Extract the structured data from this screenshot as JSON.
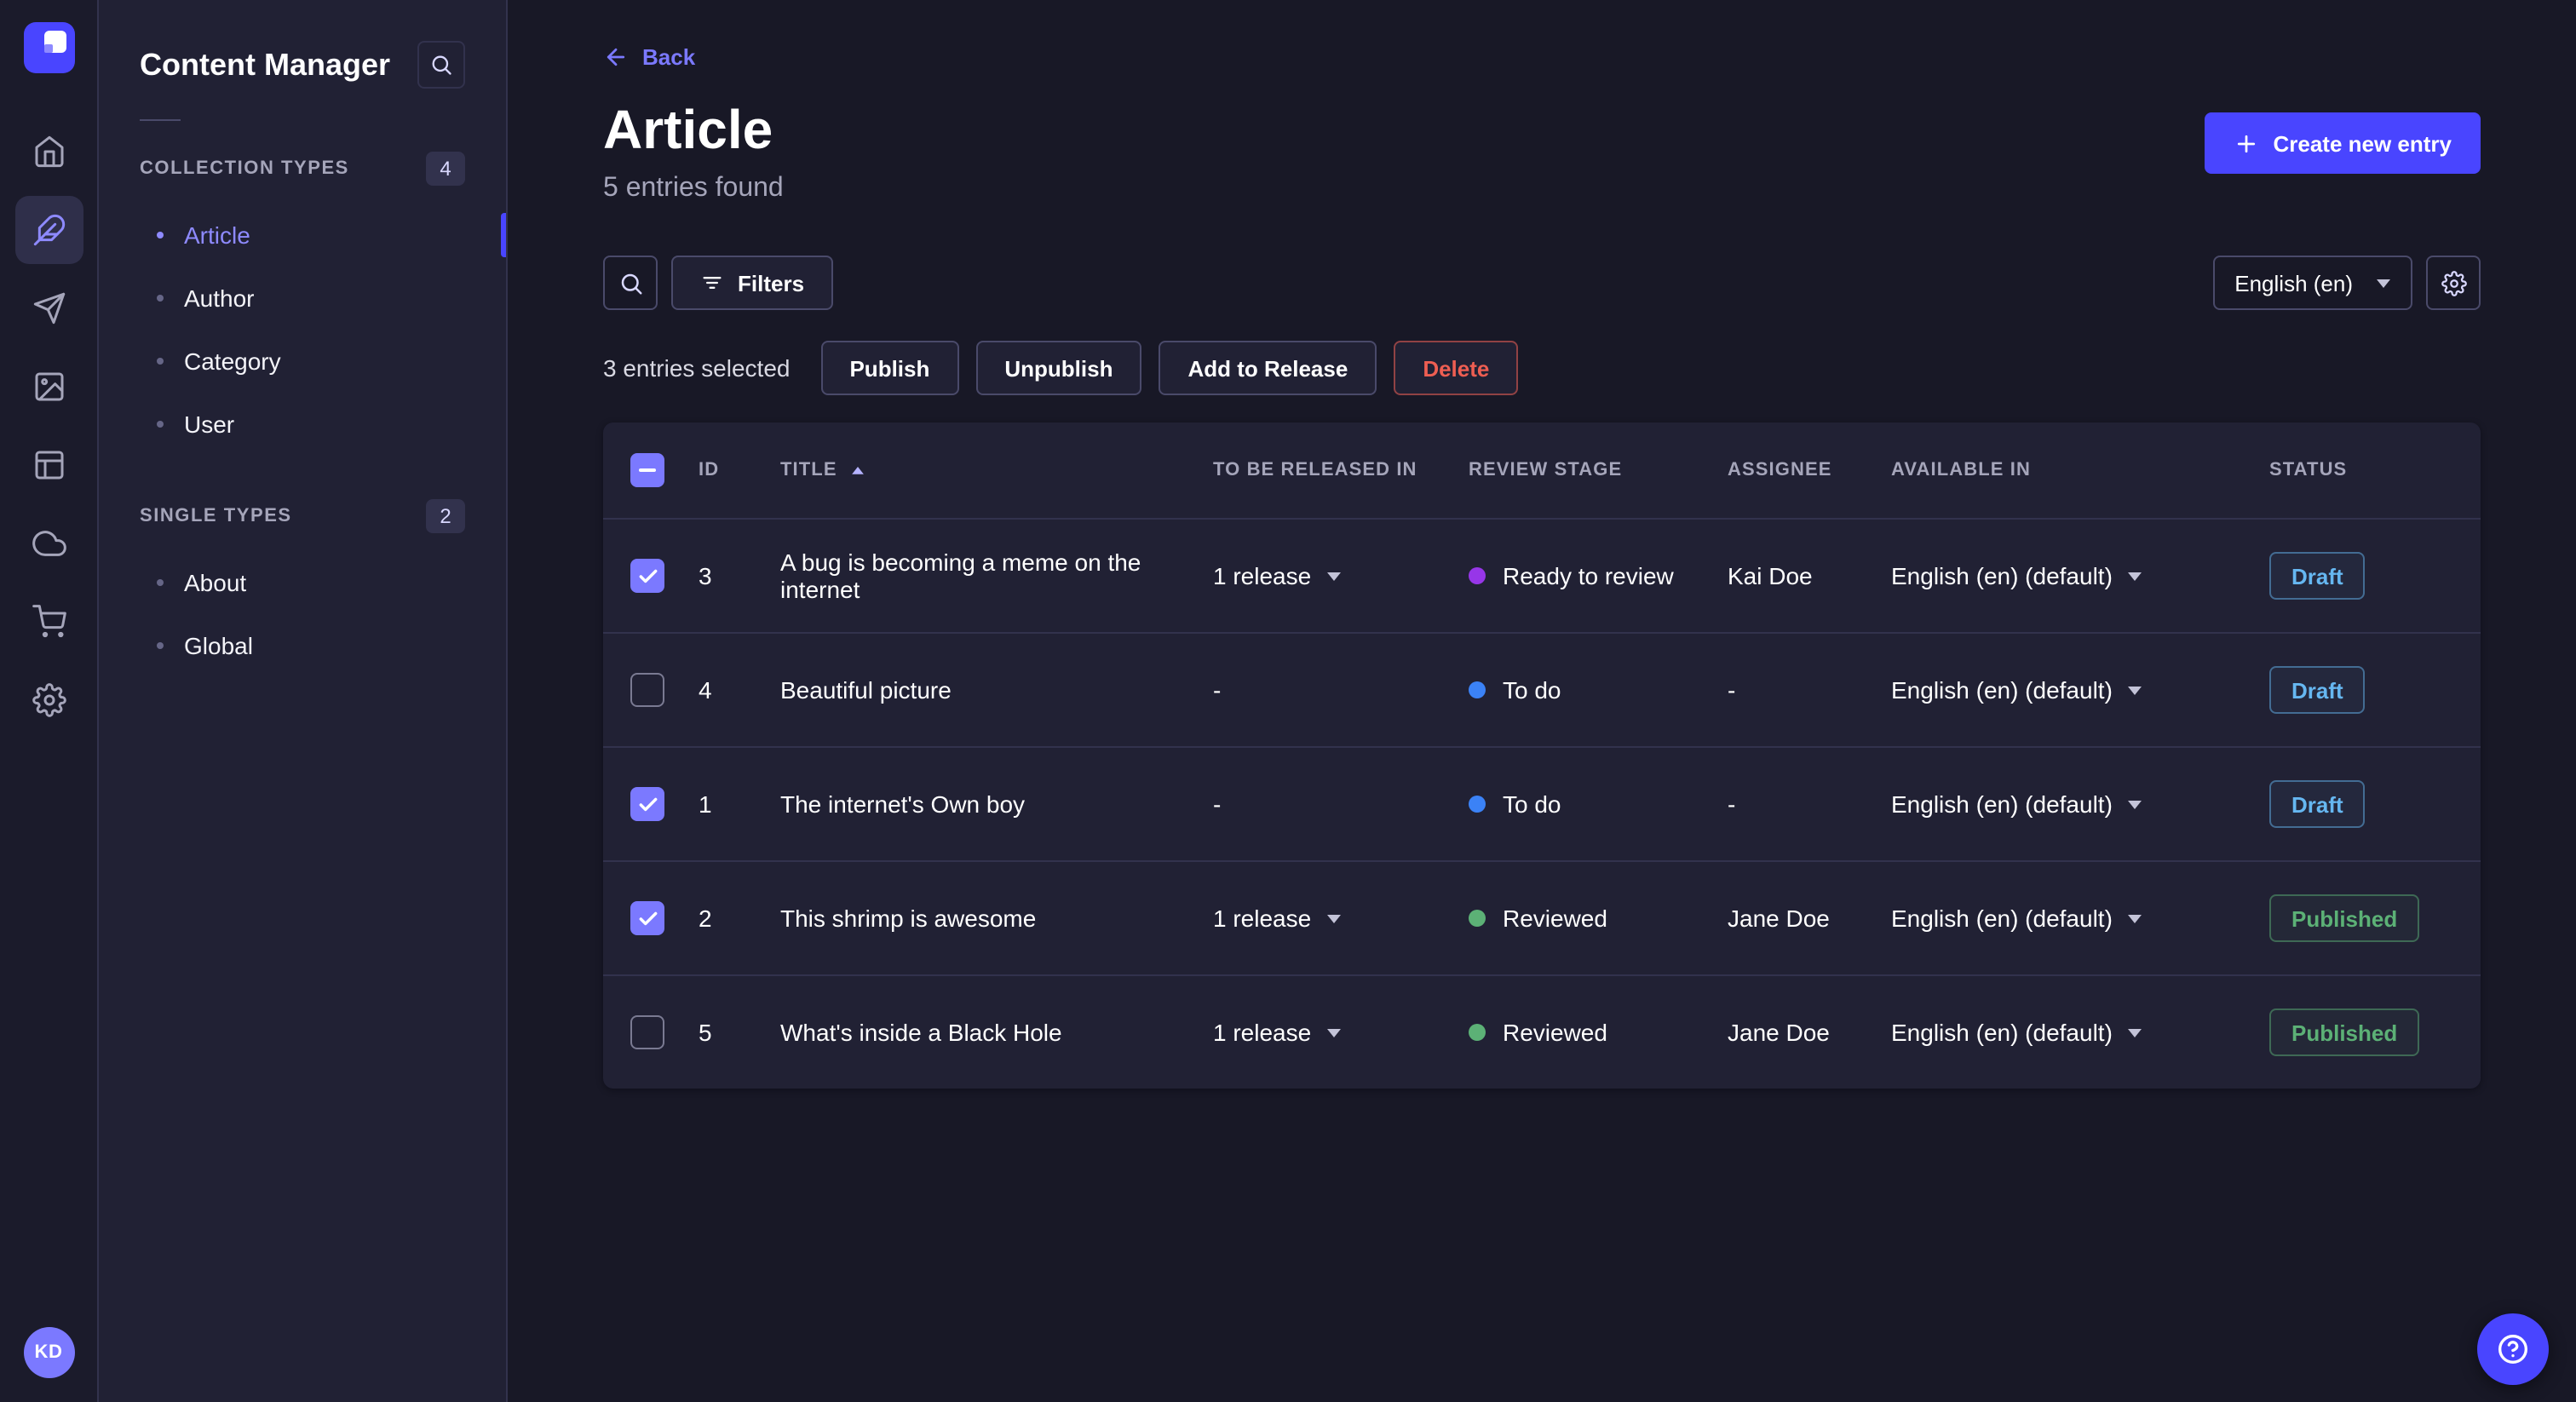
{
  "colors": {
    "primary": "#4945ff",
    "primary_light": "#7b79ff",
    "active_link": "#8e8aff",
    "status_draft": "#66b7f1",
    "status_published": "#5cb176",
    "danger": "#ee5e52",
    "stage_ready_to_review": "#9736e8",
    "stage_to_do": "#3b82f6",
    "stage_reviewed": "#5cb176"
  },
  "nav_rail": {
    "logo_icon": "strapi-logo",
    "items": [
      {
        "icon": "home-icon",
        "active": false
      },
      {
        "icon": "content-manager-icon",
        "active": true
      },
      {
        "icon": "releases-icon",
        "active": false
      },
      {
        "icon": "media-library-icon",
        "active": false
      },
      {
        "icon": "content-type-builder-icon",
        "active": false
      },
      {
        "icon": "cloud-icon",
        "active": false
      },
      {
        "icon": "marketplace-icon",
        "active": false
      },
      {
        "icon": "settings-icon",
        "active": false
      }
    ],
    "avatar_initials": "KD"
  },
  "sidebar": {
    "title": "Content Manager",
    "search_icon": "search-icon",
    "sections": [
      {
        "label": "COLLECTION TYPES",
        "badge": "4",
        "items": [
          {
            "label": "Article",
            "active": true
          },
          {
            "label": "Author",
            "active": false
          },
          {
            "label": "Category",
            "active": false
          },
          {
            "label": "User",
            "active": false
          }
        ]
      },
      {
        "label": "SINGLE TYPES",
        "badge": "2",
        "items": [
          {
            "label": "About",
            "active": false
          },
          {
            "label": "Global",
            "active": false
          }
        ]
      }
    ]
  },
  "header": {
    "back_label": "Back",
    "title": "Article",
    "subtitle": "5 entries found",
    "create_button": "Create new entry"
  },
  "toolbar": {
    "search_icon": "search-icon",
    "filters_label": "Filters",
    "filter_icon": "filter-icon",
    "locale_value": "English (en)",
    "settings_icon": "gear-icon"
  },
  "selection": {
    "text": "3 entries selected",
    "actions": [
      "Publish",
      "Unpublish",
      "Add to Release",
      "Delete"
    ]
  },
  "table": {
    "select_all_indeterminate": true,
    "sort": {
      "column": "TITLE",
      "direction": "asc"
    },
    "headers": [
      "ID",
      "TITLE",
      "TO BE RELEASED IN",
      "REVIEW STAGE",
      "ASSIGNEE",
      "AVAILABLE IN",
      "STATUS"
    ],
    "rows": [
      {
        "checked": true,
        "id": "3",
        "title": "A bug is becoming a meme on the internet",
        "release": "1 release",
        "release_menu": true,
        "stage": "Ready to review",
        "stage_color": "#9736e8",
        "assignee": "Kai Doe",
        "locale": "English (en) (default)",
        "status": "Draft",
        "status_kind": "draft"
      },
      {
        "checked": false,
        "id": "4",
        "title": "Beautiful picture",
        "release": "-",
        "release_menu": false,
        "stage": "To do",
        "stage_color": "#3b82f6",
        "assignee": "-",
        "locale": "English (en) (default)",
        "status": "Draft",
        "status_kind": "draft"
      },
      {
        "checked": true,
        "id": "1",
        "title": "The internet's Own boy",
        "release": "-",
        "release_menu": false,
        "stage": "To do",
        "stage_color": "#3b82f6",
        "assignee": "-",
        "locale": "English (en) (default)",
        "status": "Draft",
        "status_kind": "draft"
      },
      {
        "checked": true,
        "id": "2",
        "title": "This shrimp is awesome",
        "release": "1 release",
        "release_menu": true,
        "stage": "Reviewed",
        "stage_color": "#5cb176",
        "assignee": "Jane Doe",
        "locale": "English (en) (default)",
        "status": "Published",
        "status_kind": "published"
      },
      {
        "checked": false,
        "id": "5",
        "title": "What's inside a Black Hole",
        "release": "1 release",
        "release_menu": true,
        "stage": "Reviewed",
        "stage_color": "#5cb176",
        "assignee": "Jane Doe",
        "locale": "English (en) (default)",
        "status": "Published",
        "status_kind": "published"
      }
    ]
  },
  "help": {
    "icon": "help-icon"
  }
}
